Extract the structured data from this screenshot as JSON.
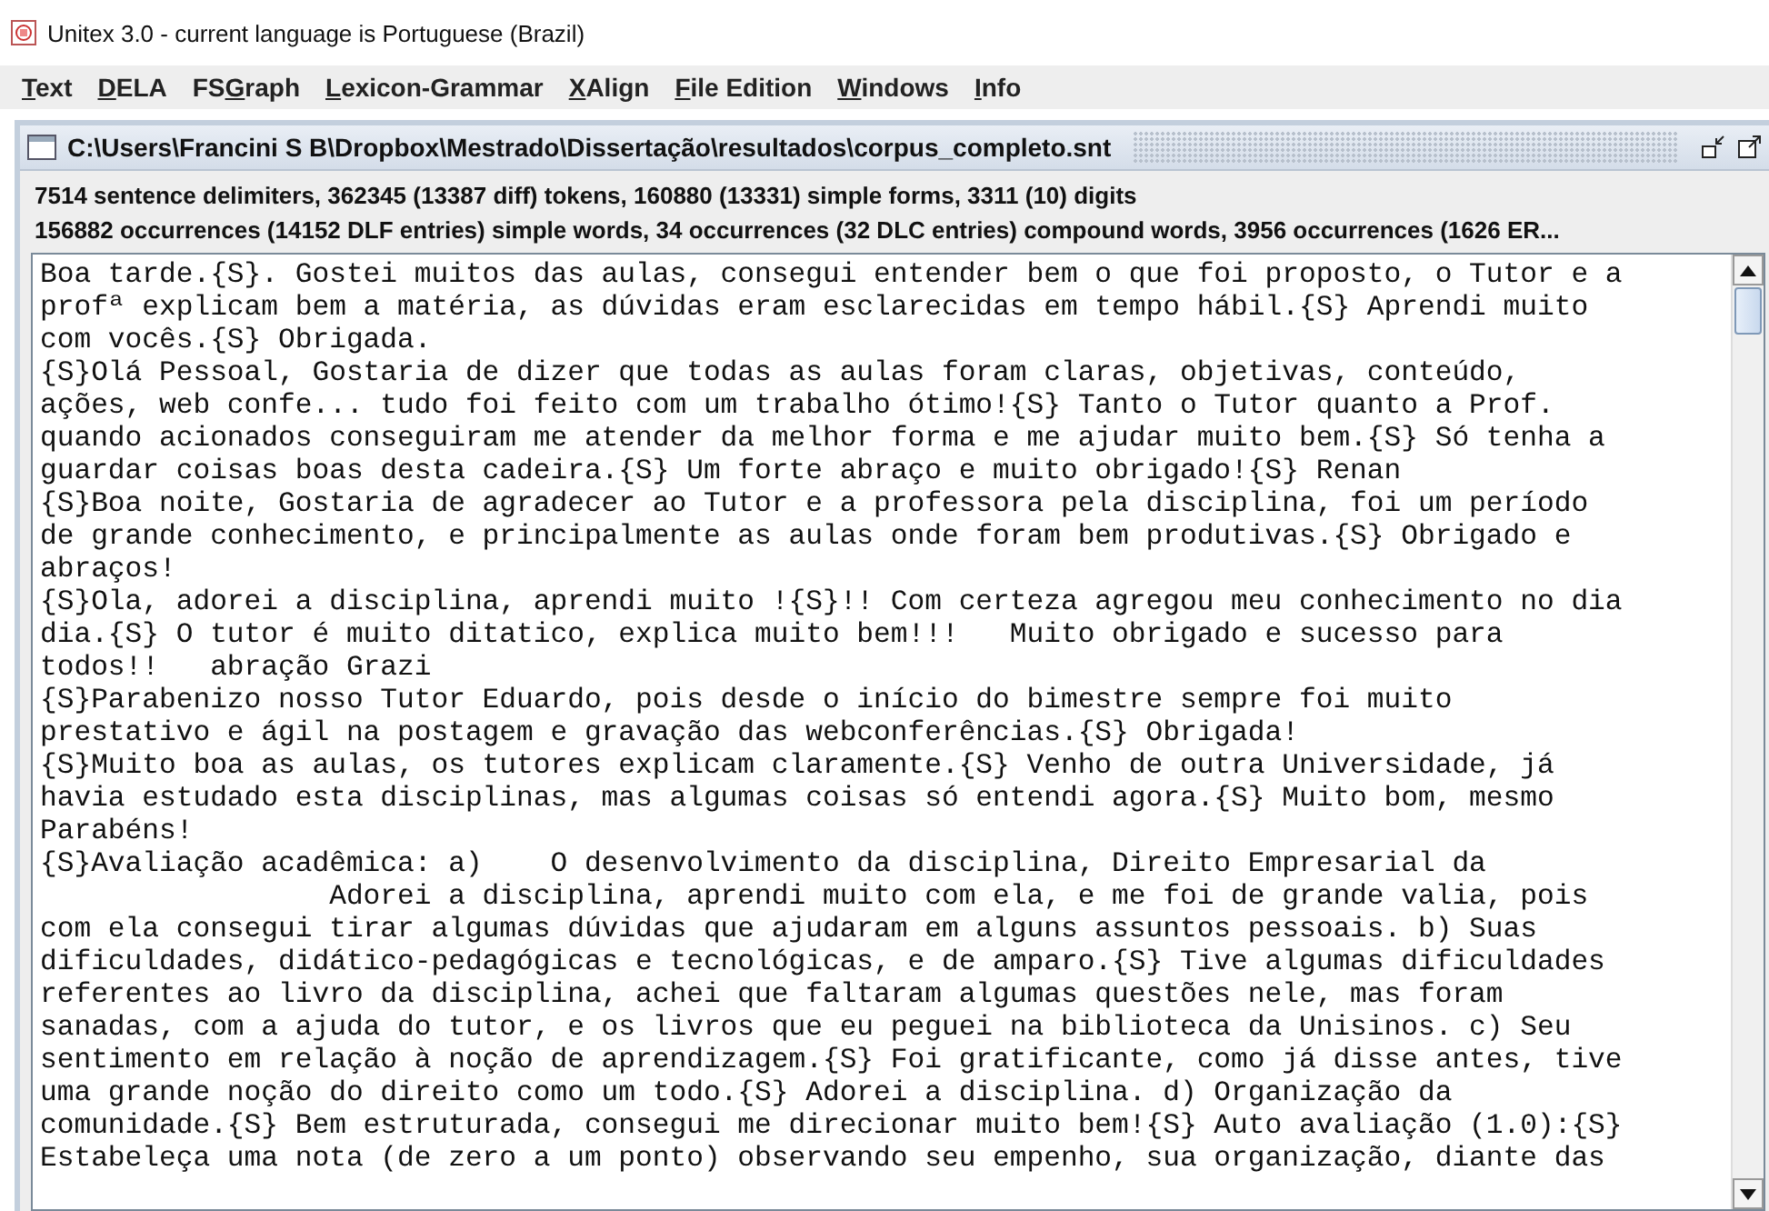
{
  "window": {
    "title": "Unitex 3.0 - current language is Portuguese (Brazil)"
  },
  "menu": [
    {
      "key": "T",
      "after": "ext"
    },
    {
      "key": "D",
      "after": "ELA"
    },
    {
      "before": "FS",
      "key": "G",
      "after": "raph"
    },
    {
      "key": "L",
      "after": "exicon-Grammar"
    },
    {
      "key": "X",
      "after": "Align"
    },
    {
      "key": "F",
      "after": "ile Edition"
    },
    {
      "key": "W",
      "after": "indows"
    },
    {
      "key": "I",
      "after": "nfo"
    }
  ],
  "document": {
    "title": "C:\\Users\\Francini S B\\Dropbox\\Mestrado\\Dissertação\\resultados\\corpus_completo.snt",
    "stats": [
      "7514 sentence delimiters, 362345 (13387 diff) tokens, 160880 (13331) simple forms, 3311 (10) digits",
      "156882 occurrences (14152 DLF entries) simple words, 34 occurrences (32 DLC entries) compound words, 3956 occurrences (1626 ER..."
    ],
    "lines": [
      "Boa tarde.{S}. Gostei muitos das aulas, consegui entender bem o que foi proposto, o Tutor e a",
      "profª explicam bem a matéria, as dúvidas eram esclarecidas em tempo hábil.{S} Aprendi muito",
      "com vocês.{S} Obrigada.",
      "{S}Olá Pessoal, Gostaria de dizer que todas as aulas foram claras, objetivas, conteúdo,",
      "ações, web confe... tudo foi feito com um trabalho ótimo!{S} Tanto o Tutor quanto a Prof.",
      "quando acionados conseguiram me atender da melhor forma e me ajudar muito bem.{S} Só tenha a",
      "guardar coisas boas desta cadeira.{S} Um forte abraço e muito obrigado!{S} Renan",
      "{S}Boa noite, Gostaria de agradecer ao Tutor e a professora pela disciplina, foi um período",
      "de grande conhecimento, e principalmente as aulas onde foram bem produtivas.{S} Obrigado e",
      "abraços!",
      "{S}Ola, adorei a disciplina, aprendi muito !{S}!! Com certeza agregou meu conhecimento no dia",
      "dia.{S} O tutor é muito ditatico, explica muito bem!!!   Muito obrigado e sucesso para",
      "todos!!   abração Grazi",
      "{S}Parabenizo nosso Tutor Eduardo, pois desde o início do bimestre sempre foi muito",
      "prestativo e ágil na postagem e gravação das webconferências.{S} Obrigada!",
      "{S}Muito boa as aulas, os tutores explicam claramente.{S} Venho de outra Universidade, já",
      "havia estudado esta disciplinas, mas algumas coisas só entendi agora.{S} Muito bom, mesmo",
      "Parabéns!",
      "{S}Avaliação acadêmica: a)    O desenvolvimento da disciplina, Direito Empresarial da",
      "                 Adorei a disciplina, aprendi muito com ela, e me foi de grande valia, pois",
      "com ela consegui tirar algumas dúvidas que ajudaram em alguns assuntos pessoais. b) Suas",
      "dificuldades, didático-pedagógicas e tecnológicas, e de amparo.{S} Tive algumas dificuldades",
      "referentes ao livro da disciplina, achei que faltaram algumas questões nele, mas foram",
      "sanadas, com a ajuda do tutor, e os livros que eu peguei na biblioteca da Unisinos. c) Seu",
      "sentimento em relação à noção de aprendizagem.{S} Foi gratificante, como já disse antes, tive",
      "uma grande noção do direito como um todo.{S} Adorei a disciplina. d) Organização da",
      "comunidade.{S} Bem estruturada, consegui me direcionar muito bem!{S} Auto avaliação (1.0):{S}",
      "Estabeleça uma nota (de zero a um ponto) observando seu empenho, sua organização, diante das"
    ]
  }
}
